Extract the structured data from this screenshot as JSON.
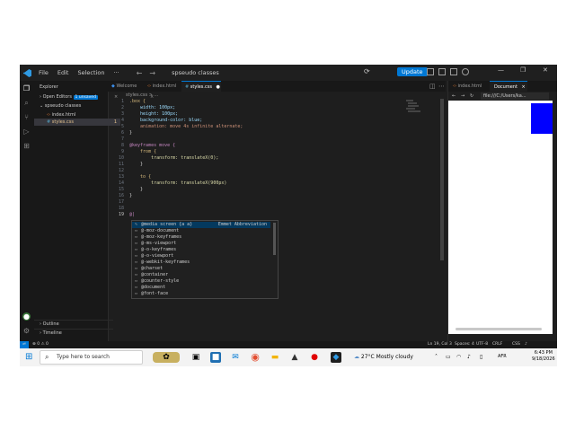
{
  "titlebar": {
    "menus": [
      "File",
      "Edit",
      "Selection",
      "···"
    ],
    "search": "spseudo classes",
    "update_label": "Update"
  },
  "sidebar": {
    "title": "Explorer",
    "open_editors": "Open Editors",
    "open_editors_badge": "1 unsaved",
    "folder": "spseudo classes",
    "files": [
      "index.html",
      "styles.css"
    ],
    "styles_badge": "1",
    "outline": "Outline",
    "timeline": "Timeline"
  },
  "editor": {
    "tabs": [
      "Welcome",
      "index.html",
      "styles.css"
    ],
    "breadcrumb": "styles.css > ...",
    "line_numbers": [
      "1",
      "2",
      "3",
      "4",
      "5",
      "6",
      "7",
      "8",
      "9",
      "10",
      "11",
      "12",
      "13",
      "14",
      "15",
      "16",
      "17",
      "18",
      "19"
    ],
    "code": [
      ".box {",
      "    width: 100px;",
      "    height: 100px;",
      "    background-color: blue;",
      "    animation: move 4s infinite alternate;",
      "}",
      "",
      "@keyframes move {",
      "    from {",
      "        transform: translateX(0);",
      "    }",
      "",
      "    to {",
      "        transform: translateX(900px)",
      "    }",
      "}",
      "",
      "",
      "@|"
    ]
  },
  "autocomplete": {
    "items": [
      "@media screen {a        a}",
      "@-moz-document",
      "@-moz-keyframes",
      "@-ms-viewport",
      "@-o-keyframes",
      "@-o-viewport",
      "@-webkit-keyframes",
      "@charset",
      "@container",
      "@counter-style",
      "@document",
      "@font-face"
    ],
    "detail": "Emmet Abbreviation"
  },
  "preview": {
    "tabs": [
      "index.html",
      "Document"
    ],
    "url": "file:///C:/Users/ka..."
  },
  "status": {
    "left": "⊗ 0 ⚠ 0",
    "position": "Ln 19, Col 3",
    "spaces": "Spaces: 4",
    "encoding": "UTF-8",
    "eol": "CRLF",
    "language": "CSS"
  },
  "taskbar": {
    "search_placeholder": "Type here to search",
    "weather": "27°C  Mostly cloudy",
    "lang": "AFR",
    "time": "6:43 PM",
    "date": "9/18/2026"
  },
  "colors": {
    "accent": "#0078d4",
    "box": "#0000ff"
  }
}
